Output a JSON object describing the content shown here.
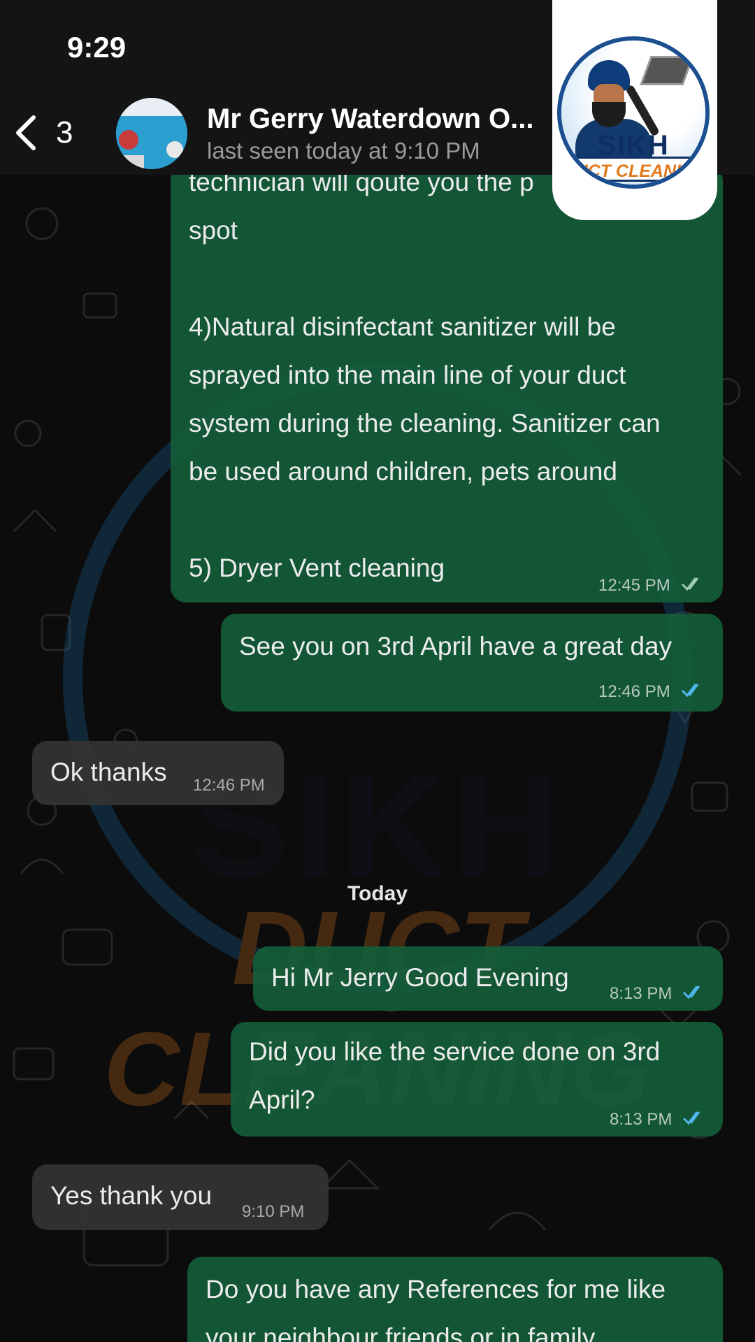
{
  "status_bar": {
    "time": "9:29"
  },
  "header": {
    "back_count": "3",
    "contact_name": "Mr Gerry Waterdown O...",
    "last_seen": "last seen today at 9:10 PM",
    "back_icon": "chevron-left-icon"
  },
  "logo": {
    "line1": "SIKH",
    "line2": "DUCT CLEANING"
  },
  "watermark": {
    "line1": "SIKH",
    "line2": "DUCT CLEANING"
  },
  "messages": [
    {
      "direction": "outgoing",
      "text": "technician will qoute you the p\nspot\n\n4)Natural disinfectant sanitizer will be\nsprayed into the main line of your duct\nsystem during the cleaning. Sanitizer can\nbe used around children, pets around\n\n5) Dryer Vent cleaning",
      "time": "12:45 PM",
      "status": "read"
    },
    {
      "direction": "outgoing",
      "text": "See you on 3rd April have a great day",
      "time": "12:46 PM",
      "status": "read"
    },
    {
      "direction": "incoming",
      "text": "Ok thanks",
      "time": "12:46 PM"
    },
    {
      "direction": "outgoing",
      "text": "Hi Mr Jerry Good Evening",
      "time": "8:13 PM",
      "status": "read"
    },
    {
      "direction": "outgoing",
      "text": "Did you like the service done on 3rd\nApril?",
      "time": "8:13 PM",
      "status": "read"
    },
    {
      "direction": "incoming",
      "text": "Yes thank you",
      "time": "9:10 PM"
    },
    {
      "direction": "outgoing",
      "text": "Do you have any References for me like\nyour neighbour friends or in family"
    }
  ],
  "day_separator": "Today",
  "colors": {
    "outgoing_bubble": "#145c3a",
    "incoming_bubble": "#343434",
    "read_ticks": "#4fb6ec"
  }
}
